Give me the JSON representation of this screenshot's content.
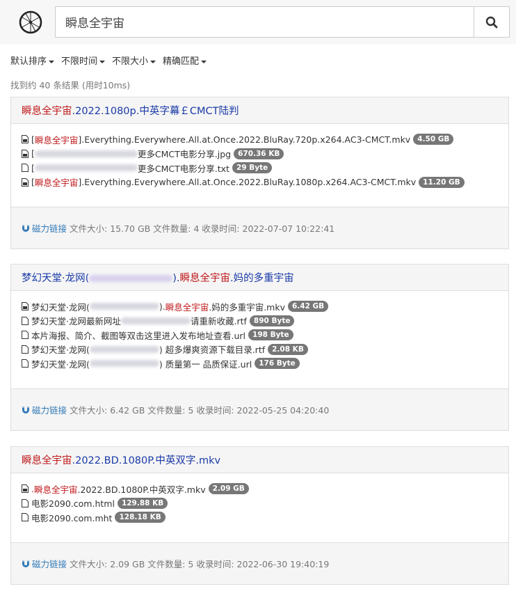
{
  "search": {
    "query": "瞬息全宇宙"
  },
  "filters": [
    "默认排序",
    "不限时间",
    "不限大小",
    "精确匹配"
  ],
  "result_count": "找到约 40 条结果 (用时10ms)",
  "icons": {
    "logo": "bicycle-wheel-icon",
    "search": "search-icon",
    "file": "file-icon",
    "magnet": "magnet-icon"
  },
  "colors": {
    "link": "#1a3aa8",
    "highlight": "#c0191b",
    "badge": "#777777",
    "magnet": "#337ab7"
  },
  "results": [
    {
      "title_hl": "瞬息全宇宙",
      "title_rest": ".2022.1080p.中英字幕￡CMCT陆判",
      "files": [
        {
          "pre": "[",
          "hl": "瞬息全宇宙",
          "post": "].Everything.Everywhere.All.at.Once.2022.BluRay.720p.x264.AC3-CMCT.mkv",
          "size": "4.50 GB"
        },
        {
          "pre": "[",
          "hl": "",
          "post": "更多CMCT电影分享.jpg",
          "size": "670.36 KB"
        },
        {
          "pre": "[",
          "hl": "",
          "post": "更多CMCT电影分享.txt",
          "size": "29 Byte"
        },
        {
          "pre": "[",
          "hl": "瞬息全宇宙",
          "post": "].Everything.Everywhere.All.at.Once.2022.BluRay.1080p.x264.AC3-CMCT.mkv",
          "size": "11.20 GB"
        }
      ],
      "magnet_label": "磁力链接",
      "meta": "文件大小: 15.70 GB 文件数量: 4 收录时间: 2022-07-07 10:22:41"
    },
    {
      "title_pre": "梦幻天堂·龙网(",
      "title_mid": ").",
      "title_hl": "瞬息全宇宙",
      "title_rest": ".妈的多重宇宙",
      "files": [
        {
          "pre": "梦幻天堂·龙网(",
          "mid": ").",
          "hl": "瞬息全宇宙",
          "post": ".妈的多重宇宙.mkv",
          "size": "6.42 GB"
        },
        {
          "pre": "梦幻天堂·龙网最新网址",
          "mid": " 请重新收藏.rtf",
          "hl": "",
          "post": "",
          "size": "890 Byte"
        },
        {
          "pre": "本片海报、简介、截图等双击这里进入发布地址查看.url",
          "mid": "",
          "hl": "",
          "post": "",
          "size": "198 Byte"
        },
        {
          "pre": "梦幻天堂·龙网(",
          "mid": ") 超多爆爽资源下载目录.rtf",
          "hl": "",
          "post": "",
          "size": "2.08 KB"
        },
        {
          "pre": "梦幻天堂·龙网(",
          "mid": ") 质量第一 品质保证.url",
          "hl": "",
          "post": "",
          "size": "176 Byte"
        }
      ],
      "magnet_label": "磁力链接",
      "meta": "文件大小: 6.42 GB 文件数量: 5 收录时间: 2022-05-25 04:20:40"
    },
    {
      "title_hl": "瞬息全宇宙",
      "title_rest": ".2022.BD.1080P.中英双字.mkv",
      "files": [
        {
          "pre": ".",
          "hl": "瞬息全宇宙",
          "post": ".2022.BD.1080P.中英双字.mkv",
          "size": "2.09 GB"
        },
        {
          "pre": "电影2090.com.html",
          "hl": "",
          "post": "",
          "size": "129.88 KB"
        },
        {
          "pre": "电影2090.com.mht",
          "hl": "",
          "post": "",
          "size": "128.18 KB"
        }
      ],
      "magnet_label": "磁力链接",
      "meta": "文件大小: 2.09 GB 文件数量: 5 收录时间: 2022-06-30 19:40:19"
    }
  ]
}
